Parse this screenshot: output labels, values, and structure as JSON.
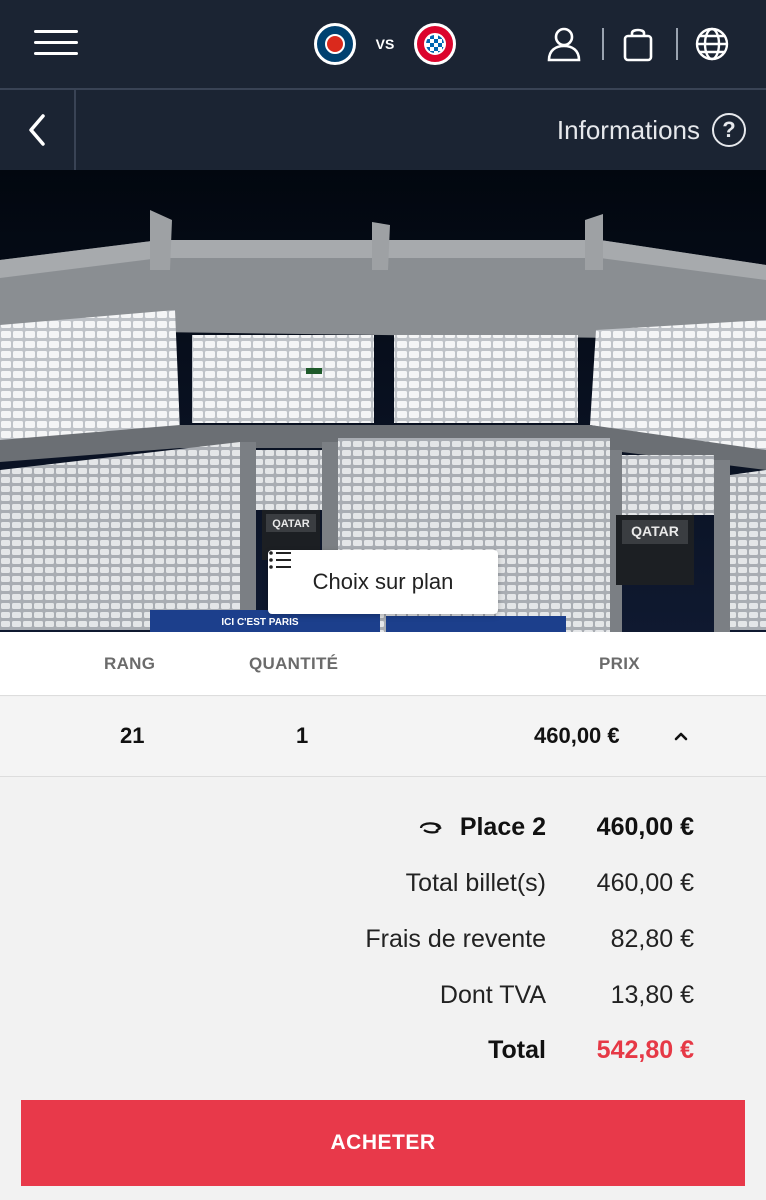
{
  "header": {
    "home_team": "PSG",
    "away_team": "FC Bayern München",
    "vs_label": "VS",
    "icons": [
      "menu-icon",
      "user-icon",
      "cart-icon",
      "globe-icon"
    ]
  },
  "subheader": {
    "info_label": "Informations",
    "info_icon_glyph": "?"
  },
  "stadium": {
    "plan_button_label": "Choix sur plan",
    "banner_text": "ICI C'EST PARIS",
    "box_brand": "QATAR"
  },
  "table": {
    "columns": [
      "RANG",
      "QUANTITÉ",
      "PRIX"
    ],
    "row": {
      "rang": "21",
      "quantite": "1",
      "prix": "460,00 €"
    }
  },
  "details": {
    "place_label": "Place 2",
    "place_value": "460,00 €",
    "lines": [
      {
        "label": "Total billet(s)",
        "value": "460,00 €"
      },
      {
        "label": "Frais de revente",
        "value": "82,80 €"
      },
      {
        "label": "Dont TVA",
        "value": "13,80 €"
      }
    ],
    "total_label": "Total",
    "total_value": "542,80 €"
  },
  "actions": {
    "buy_label": "ACHETER"
  },
  "colors": {
    "navy": "#1b2433",
    "accent_red": "#e8394a",
    "total_red": "#e63946"
  }
}
